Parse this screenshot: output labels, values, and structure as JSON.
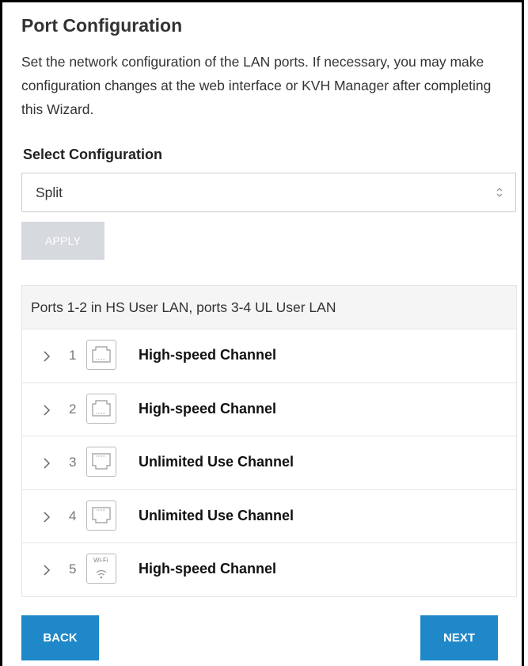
{
  "page": {
    "title": "Port Configuration",
    "description": "Set the network configuration of the LAN ports. If necessary, you may make configuration changes at the web interface or KVH Manager after completing this Wizard."
  },
  "select": {
    "label": "Select Configuration",
    "value": "Split"
  },
  "apply_label": "APPLY",
  "ports": {
    "summary": "Ports 1-2 in HS User LAN, ports 3-4 UL User LAN",
    "rows": [
      {
        "num": "1",
        "icon": "ethernet-port-icon",
        "label": "High-speed Channel"
      },
      {
        "num": "2",
        "icon": "ethernet-port-icon",
        "label": "High-speed Channel"
      },
      {
        "num": "3",
        "icon": "ethernet-port-inverted-icon",
        "label": "Unlimited Use Channel"
      },
      {
        "num": "4",
        "icon": "ethernet-port-inverted-icon",
        "label": "Unlimited Use Channel"
      },
      {
        "num": "5",
        "icon": "wifi-icon",
        "icon_text": "Wi-Fi",
        "label": "High-speed Channel"
      }
    ]
  },
  "nav": {
    "back_label": "BACK",
    "next_label": "NEXT"
  },
  "colors": {
    "primary": "#1e88c9",
    "disabled": "#d6d9de"
  }
}
